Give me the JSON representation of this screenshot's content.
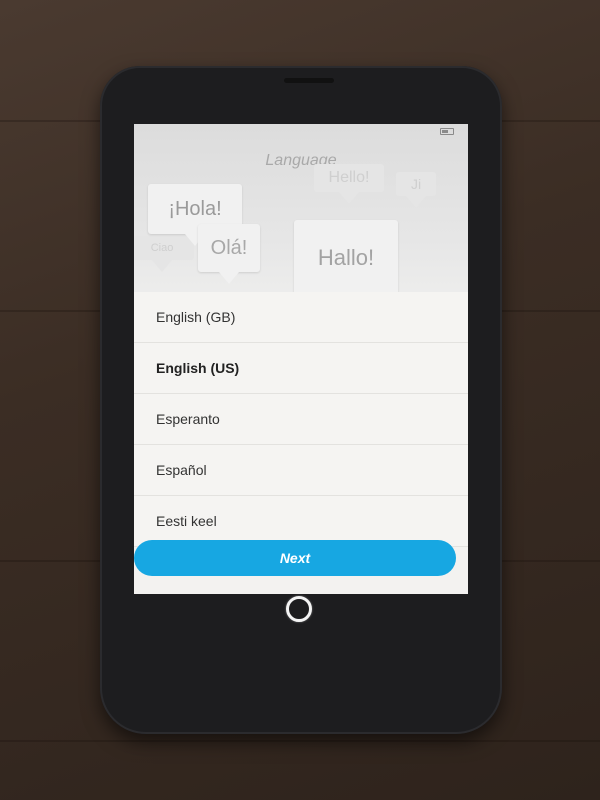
{
  "screen": {
    "title": "Language",
    "greetings": [
      "¡Hola!",
      "Olá!",
      "Hallo!",
      "Hello!",
      "Ciao",
      "Ji"
    ],
    "languages": [
      {
        "label": "English (GB)",
        "selected": false
      },
      {
        "label": "English (US)",
        "selected": true
      },
      {
        "label": "Esperanto",
        "selected": false
      },
      {
        "label": "Español",
        "selected": false
      },
      {
        "label": "Eesti keel",
        "selected": false
      }
    ],
    "next_label": "Next"
  },
  "colors": {
    "accent": "#17a7e2",
    "screen_bg": "#f3f2f0",
    "phone_body": "#1d1d1f"
  },
  "icons": {
    "battery": "battery-icon",
    "home": "home-button-icon"
  }
}
